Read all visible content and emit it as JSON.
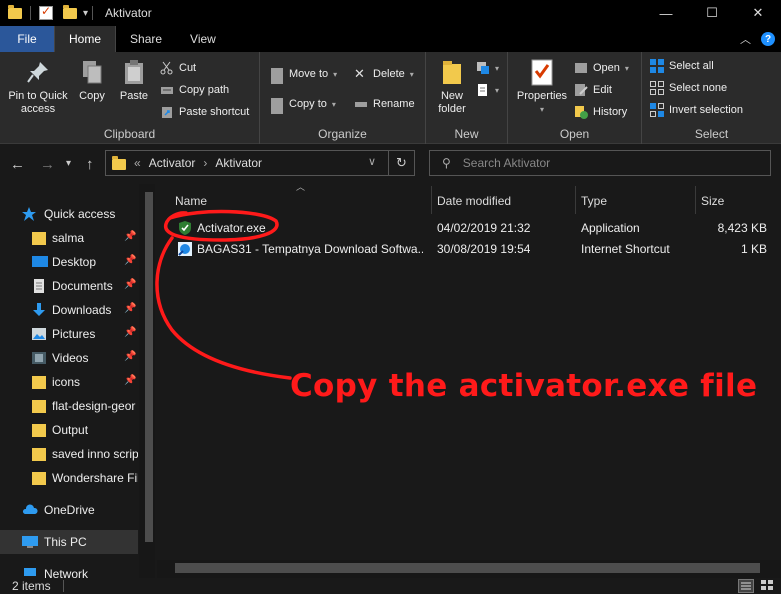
{
  "window": {
    "title": "Aktivator",
    "controls": {
      "minimize": "—",
      "maximize": "☐",
      "close": "✕"
    }
  },
  "ribbon_tabs": [
    "File",
    "Home",
    "Share",
    "View"
  ],
  "ribbon": {
    "clipboard": {
      "label": "Clipboard",
      "pin": "Pin to Quick access",
      "copy": "Copy",
      "paste": "Paste",
      "cut": "Cut",
      "copy_path": "Copy path",
      "paste_shortcut": "Paste shortcut"
    },
    "organize": {
      "label": "Organize",
      "move_to": "Move to",
      "copy_to": "Copy to",
      "delete": "Delete",
      "rename": "Rename"
    },
    "new": {
      "label": "New",
      "new_folder": "New folder"
    },
    "open": {
      "label": "Open",
      "properties": "Properties",
      "open": "Open",
      "edit": "Edit",
      "history": "History"
    },
    "select": {
      "label": "Select",
      "select_all": "Select all",
      "select_none": "Select none",
      "invert_selection": "Invert selection"
    }
  },
  "address": {
    "overflow": "«",
    "crumbs": [
      "Activator",
      "Aktivator"
    ],
    "search_placeholder": "Search Aktivator"
  },
  "nav_pane": {
    "items": [
      {
        "label": "Quick access",
        "icon": "star-icon",
        "pinned": false
      },
      {
        "label": "salma",
        "icon": "folder-icon",
        "pinned": true
      },
      {
        "label": "Desktop",
        "icon": "desktop-icon",
        "pinned": true
      },
      {
        "label": "Documents",
        "icon": "documents-icon",
        "pinned": true
      },
      {
        "label": "Downloads",
        "icon": "download-icon",
        "pinned": true
      },
      {
        "label": "Pictures",
        "icon": "pictures-icon",
        "pinned": true
      },
      {
        "label": "Videos",
        "icon": "videos-icon",
        "pinned": true
      },
      {
        "label": "icons",
        "icon": "folder-icon",
        "pinned": true
      },
      {
        "label": "flat-design-geor",
        "icon": "folder-icon",
        "pinned": false
      },
      {
        "label": "Output",
        "icon": "folder-icon",
        "pinned": false
      },
      {
        "label": "saved inno script",
        "icon": "folder-icon",
        "pinned": false
      },
      {
        "label": "Wondershare Fil",
        "icon": "folder-icon",
        "pinned": false
      },
      {
        "label": "OneDrive",
        "icon": "cloud-icon",
        "pinned": false
      },
      {
        "label": "This PC",
        "icon": "computer-icon",
        "pinned": false
      },
      {
        "label": "Network",
        "icon": "network-icon",
        "pinned": false
      }
    ]
  },
  "columns": [
    "Name",
    "Date modified",
    "Type",
    "Size"
  ],
  "files": [
    {
      "name": "Activator.exe",
      "date": "04/02/2019 21:32",
      "type": "Application",
      "size": "8,423 KB",
      "icon": "shield-app-icon"
    },
    {
      "name": "BAGAS31 - Tempatnya Download Softwa...",
      "date": "30/08/2019 19:54",
      "type": "Internet Shortcut",
      "size": "1 KB",
      "icon": "internet-shortcut-icon"
    }
  ],
  "status": {
    "item_count": "2 items"
  },
  "annotation": {
    "text": "Copy the activator.exe file",
    "color": "#ff1a1a"
  },
  "colors": {
    "file_tab": "#2b579a",
    "ribbon_bg": "#2b2b2b",
    "background": "#191919",
    "folder": "#f2c94c"
  }
}
